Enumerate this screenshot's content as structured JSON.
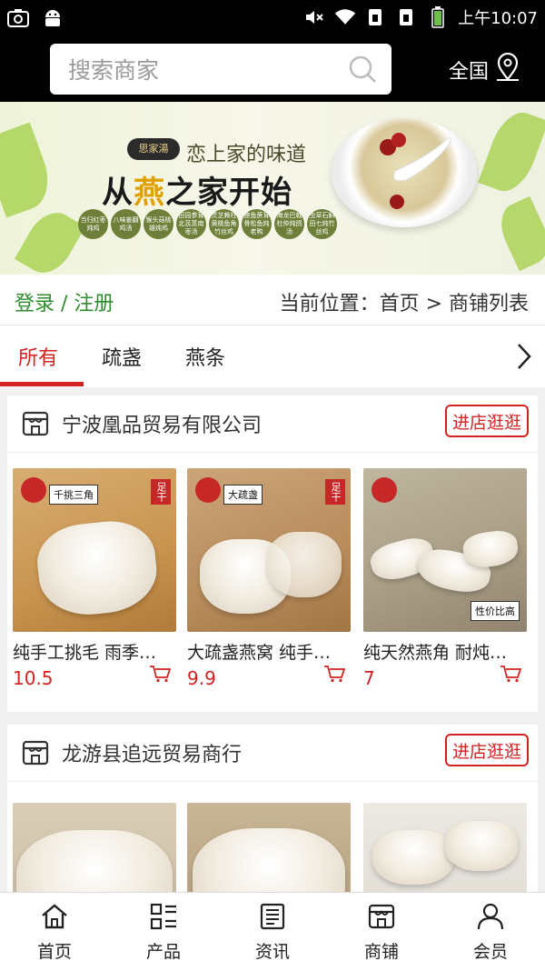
{
  "status_bar": {
    "time": "上午10:07"
  },
  "header": {
    "search_placeholder": "搜索商家",
    "region_label": "全国"
  },
  "banner": {
    "brand": "思家湯",
    "tagline": "恋上家的味道",
    "headline_prefix": "从",
    "headline_highlight": "燕",
    "headline_suffix": "之家开始",
    "dishes": [
      "当归红枣炖鸡",
      "八味姜翻鸡汤",
      "猴头菇桃雄炖鸡",
      "田园参茸北芪蒸南枣汤",
      "灵芝赖柱黄桃鱼角竹丝鸡",
      "鲍鱼蔗茸骨松鱼炖老鸭",
      "海龙巴戟杜仲炖鸽汤",
      "虫草石斛田七炖竹丝鸡"
    ]
  },
  "breadcrumb": {
    "login_register": "登录 / 注册",
    "location": "当前位置：首页 > 商铺列表"
  },
  "tabs": [
    {
      "label": "所有",
      "active": true
    },
    {
      "label": "疏盏",
      "active": false
    },
    {
      "label": "燕条",
      "active": false
    }
  ],
  "shops": [
    {
      "name": "宁波凰品贸易有限公司",
      "enter_label": "进店逛逛",
      "products": [
        {
          "title": "纯手工挑毛 雨季…",
          "price": "10.5",
          "badge": "千挑三角",
          "sub_badge": "足干"
        },
        {
          "title": "大疏盏燕窝 纯手…",
          "price": "9.9",
          "badge": "大疏盏",
          "sub_badge": "足干"
        },
        {
          "title": "纯天然燕角 耐炖…",
          "price": "7",
          "badge": "性价比高",
          "sub_badge": ""
        }
      ]
    },
    {
      "name": "龙游县追远贸易商行",
      "enter_label": "进店逛逛",
      "products": [
        {
          "title": "",
          "price": ""
        },
        {
          "title": "",
          "price": ""
        },
        {
          "title": "",
          "price": ""
        }
      ]
    }
  ],
  "bottom_nav": [
    {
      "label": "首页",
      "icon": "home-icon"
    },
    {
      "label": "产品",
      "icon": "grid-list-icon"
    },
    {
      "label": "资讯",
      "icon": "news-icon"
    },
    {
      "label": "商铺",
      "icon": "store-icon"
    },
    {
      "label": "会员",
      "icon": "user-icon"
    }
  ],
  "colors": {
    "accent": "#d32222",
    "login_green": "#2e8b2e",
    "header_bg": "#000000"
  }
}
